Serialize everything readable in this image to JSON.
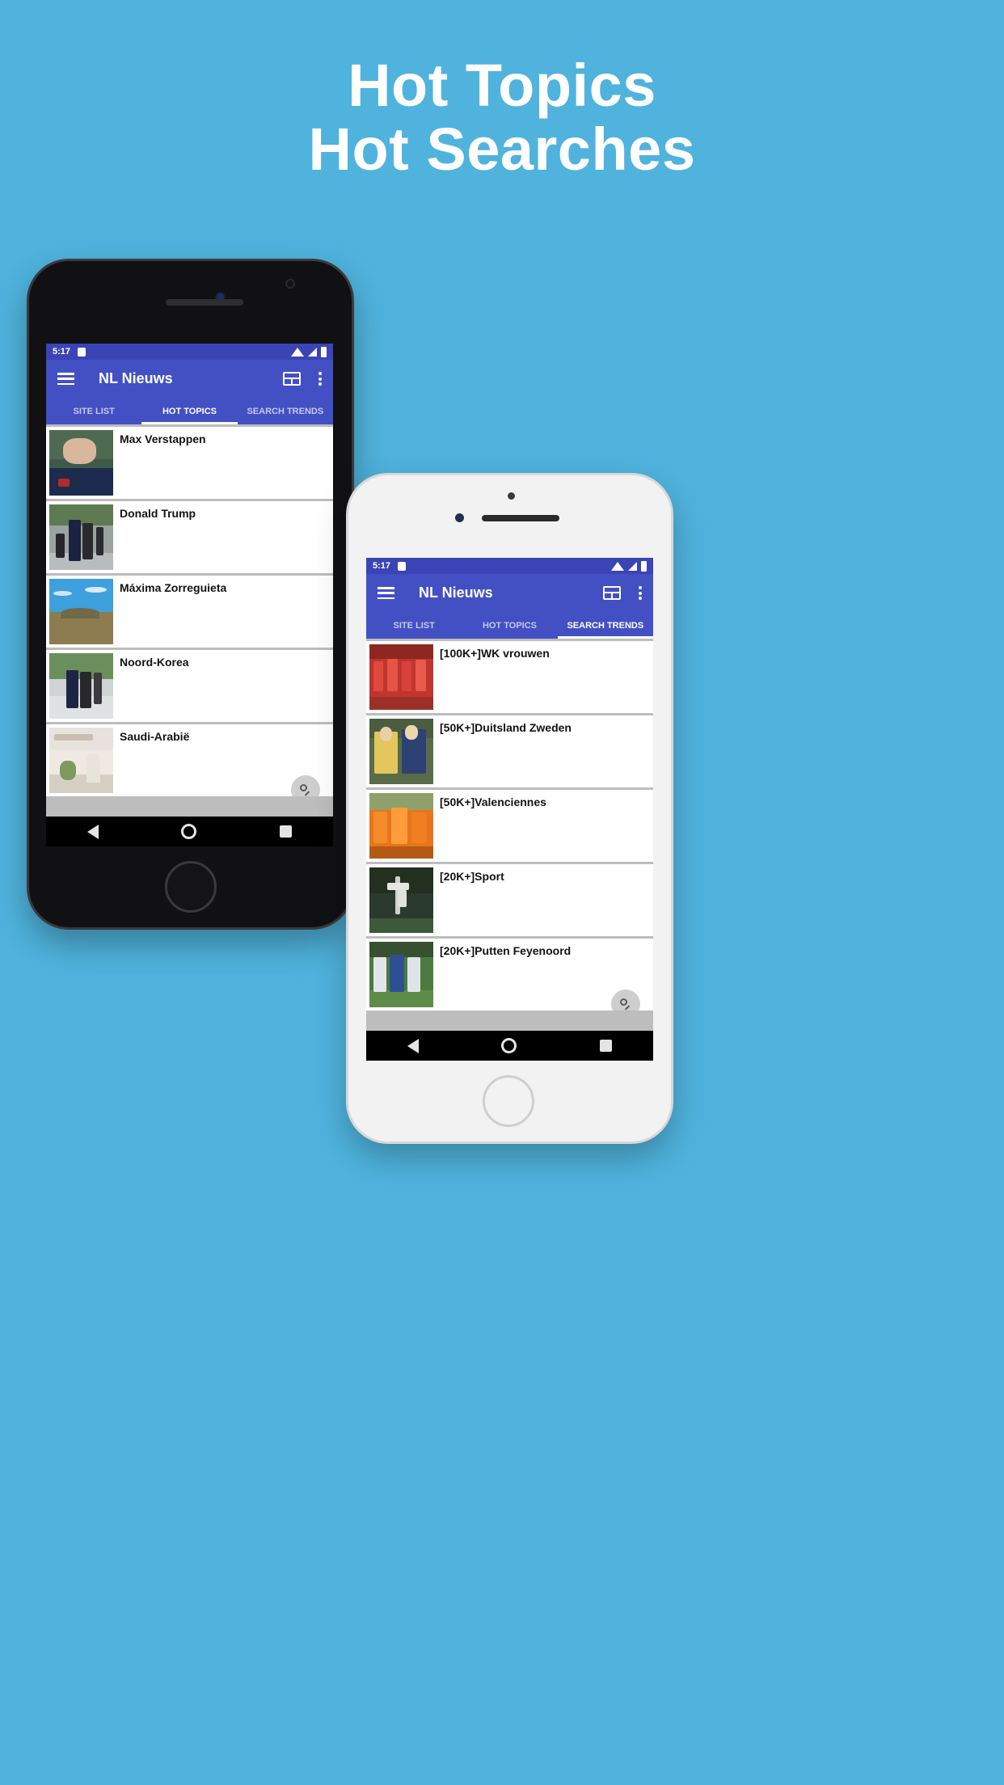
{
  "headline": {
    "line1": "Hot Topics",
    "line2": "Hot Searches"
  },
  "background_color": "#4fb3dd",
  "accent_color": "#4350c4",
  "status_bar_color": "#3b44b5",
  "phone_left": {
    "frame": "dark",
    "status": {
      "time": "5:17",
      "sd_icon": "sd-card-icon",
      "wifi_icon": "wifi-icon",
      "signal_icon": "signal-icon",
      "battery_icon": "battery-icon"
    },
    "appbar": {
      "menu_icon": "hamburger-menu-icon",
      "title": "NL Nieuws",
      "dashboard_icon": "dashboard-layout-icon",
      "overflow_icon": "more-vertical-icon"
    },
    "tabs": [
      {
        "label": "SITE LIST",
        "active": false
      },
      {
        "label": "HOT TOPICS",
        "active": true
      },
      {
        "label": "SEARCH TRENDS",
        "active": false
      }
    ],
    "items": [
      {
        "title": "Max Verstappen",
        "thumb": "portrait-man-redbull"
      },
      {
        "title": "Donald Trump",
        "thumb": "two-men-walking"
      },
      {
        "title": "Máxima Zorreguieta",
        "thumb": "landscape-hill-sky"
      },
      {
        "title": "Noord-Korea",
        "thumb": "two-leaders-handshake"
      },
      {
        "title": "Saudi-Arabië",
        "thumb": "summit-stage-white"
      }
    ],
    "fab_icon": "search-icon",
    "navbar": {
      "back_icon": "nav-back-icon",
      "home_icon": "nav-home-icon",
      "recents_icon": "nav-recents-icon"
    }
  },
  "phone_right": {
    "frame": "light",
    "status": {
      "time": "5:17",
      "sd_icon": "sd-card-icon",
      "wifi_icon": "wifi-icon",
      "signal_icon": "signal-icon",
      "battery_icon": "battery-icon"
    },
    "appbar": {
      "menu_icon": "hamburger-menu-icon",
      "title": "NL Nieuws",
      "dashboard_icon": "dashboard-layout-icon",
      "overflow_icon": "more-vertical-icon"
    },
    "tabs": [
      {
        "label": "SITE LIST",
        "active": false
      },
      {
        "label": "HOT TOPICS",
        "active": false
      },
      {
        "label": "SEARCH TRENDS",
        "active": true
      }
    ],
    "items": [
      {
        "title": "[100K+]WK vrouwen",
        "thumb": "football-team-red"
      },
      {
        "title": "[50K+]Duitsland Zweden",
        "thumb": "two-players-yellow"
      },
      {
        "title": "[50K+]Valenciennes",
        "thumb": "orange-crowd"
      },
      {
        "title": "[20K+]Sport",
        "thumb": "pole-vault-athlete"
      },
      {
        "title": "[20K+]Putten  Feyenoord",
        "thumb": "soccer-players-blue"
      }
    ],
    "fab_icon": "search-icon",
    "navbar": {
      "back_icon": "nav-back-icon",
      "home_icon": "nav-home-icon",
      "recents_icon": "nav-recents-icon"
    }
  }
}
